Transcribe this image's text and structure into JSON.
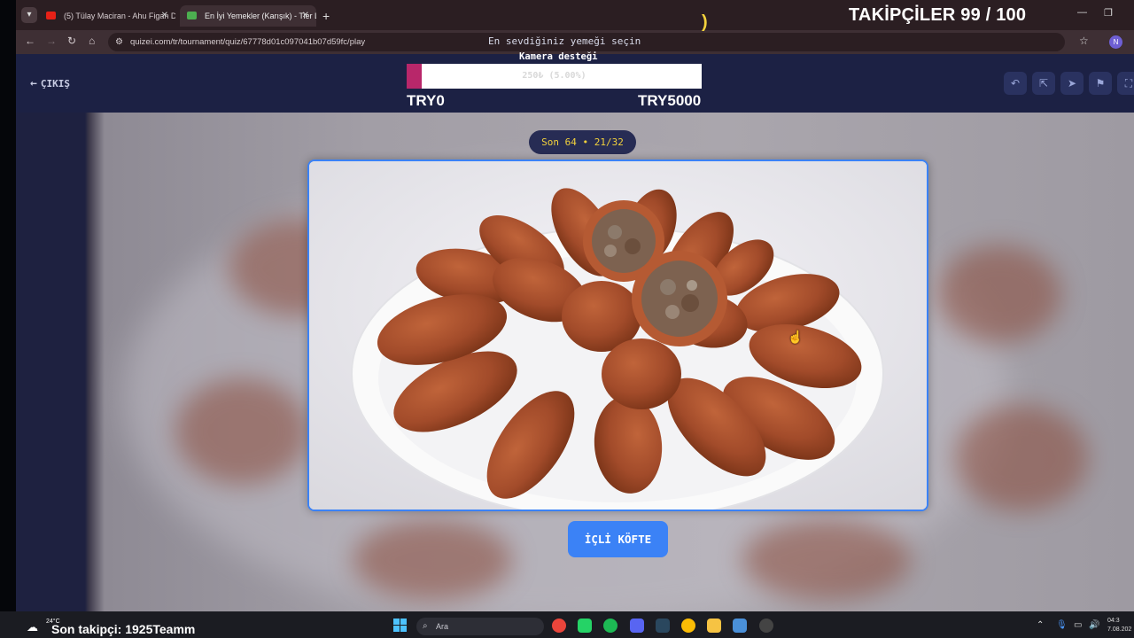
{
  "browser": {
    "tabs": [
      {
        "title": "(5) Tülay Maciran - Ahu Figan D",
        "favicon_color": "#e62117"
      },
      {
        "title": "En İyi Yemekler (Karışık) - Tier L",
        "favicon_color": "#4caf50"
      }
    ],
    "url": "quizei.com/tr/tournament/quiz/67778d01c097041b07d59fc/play",
    "profile_initial": "N"
  },
  "stream_overlay": {
    "followers_goal": "TAKİPÇİLER 99 / 100",
    "camera_support": "Kamera desteği",
    "progress_text": "250₺ (5.00%)",
    "progress_fraction": 0.05,
    "range_min": "TRY0",
    "range_max": "TRY5000",
    "last_follower": "Son takipçi: 1925Teamm"
  },
  "quiz": {
    "exit_label": "ÇIKIŞ",
    "subtitle": "En sevdiğiniz yemeği seçin",
    "round": "Son 64 • 21/32",
    "choice_label": "İÇLİ KÖFTE"
  },
  "taskbar": {
    "weather": "24°C",
    "search_placeholder": "Ara",
    "time": "04:3",
    "date": "7.08.202"
  },
  "colors": {
    "accent": "#3b82f6",
    "highlight": "#f3d23c",
    "progress_fill": "#b8276a",
    "header_bg": "#1c2144"
  }
}
